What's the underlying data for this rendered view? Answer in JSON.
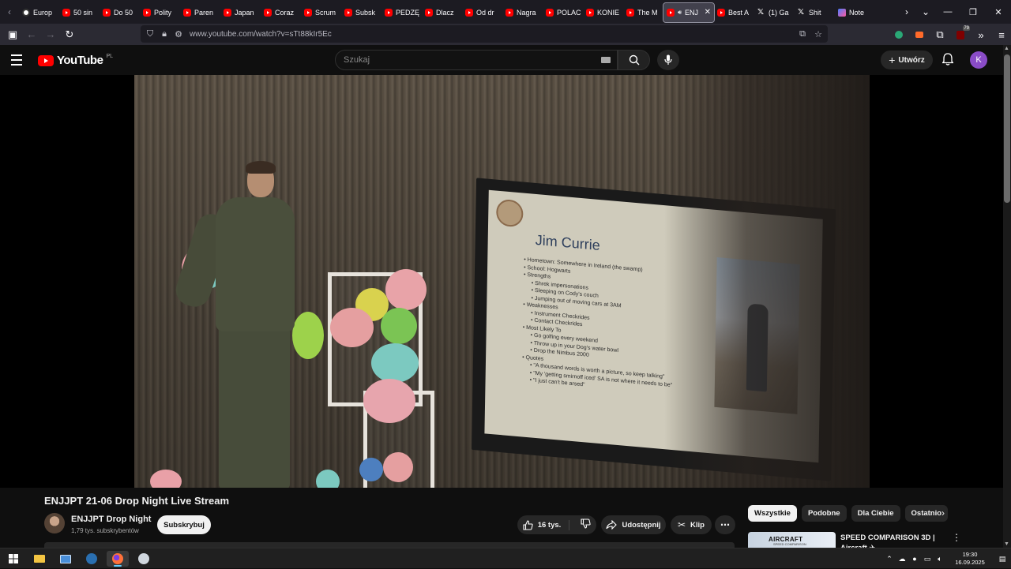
{
  "browser": {
    "tabs": [
      {
        "label": "Europ",
        "icon": "globe-icon"
      },
      {
        "label": "50 sin",
        "icon": "youtube-icon"
      },
      {
        "label": "Do 50",
        "icon": "youtube-icon"
      },
      {
        "label": "Polity",
        "icon": "youtube-icon"
      },
      {
        "label": "Paren",
        "icon": "youtube-icon"
      },
      {
        "label": "Japan",
        "icon": "youtube-icon"
      },
      {
        "label": "Coraz",
        "icon": "youtube-icon"
      },
      {
        "label": "Scrum",
        "icon": "youtube-icon"
      },
      {
        "label": "Subsk",
        "icon": "youtube-icon"
      },
      {
        "label": "PEDZĘ",
        "icon": "youtube-icon"
      },
      {
        "label": "Dlacz",
        "icon": "youtube-icon"
      },
      {
        "label": "Od dr",
        "icon": "youtube-icon"
      },
      {
        "label": "Nagra",
        "icon": "youtube-icon"
      },
      {
        "label": "POLAC",
        "icon": "youtube-icon"
      },
      {
        "label": "KONIE",
        "icon": "youtube-icon"
      },
      {
        "label": "The M",
        "icon": "youtube-icon"
      },
      {
        "label": "ENJ",
        "icon": "youtube-icon",
        "active": true
      },
      {
        "label": "Best A",
        "icon": "youtube-icon"
      },
      {
        "label": "(1) Ga",
        "icon": "x-icon"
      },
      {
        "label": "Shit",
        "icon": "x-icon"
      },
      {
        "label": "Note",
        "icon": "note-icon"
      }
    ],
    "url": "www.youtube.com/watch?v=sTt88kIr5Ec",
    "extension_badge": "79"
  },
  "youtube": {
    "logo_text": "YouTube",
    "country_code": "PL",
    "search_placeholder": "Szukaj",
    "create_label": "Utwórz",
    "avatar_letter": "K",
    "avatar_color": "#8a4cc7"
  },
  "slide": {
    "title": "Jim Currie",
    "lines": [
      {
        "level": 1,
        "text": "• Hometown:  Somewhere in Ireland (the swamp)"
      },
      {
        "level": 1,
        "text": "• School: Hogwarts"
      },
      {
        "level": 1,
        "text": "• Strengths"
      },
      {
        "level": 2,
        "text": "• Shrek impersonations"
      },
      {
        "level": 2,
        "text": "• Sleeping on Cody's couch"
      },
      {
        "level": 2,
        "text": "• Jumping out of moving cars at 3AM"
      },
      {
        "level": 1,
        "text": "• Weaknesses"
      },
      {
        "level": 2,
        "text": "• Instrument Checkrides"
      },
      {
        "level": 2,
        "text": "• Contact Checkrides"
      },
      {
        "level": 1,
        "text": "• Most Likely To"
      },
      {
        "level": 2,
        "text": "• Go golfing every weekend"
      },
      {
        "level": 2,
        "text": "• Throw up in your Dog's water bowl"
      },
      {
        "level": 2,
        "text": "• Drop the Nimbus 2000"
      },
      {
        "level": 1,
        "text": "• Quotes"
      },
      {
        "level": 2,
        "text": "• \"A thousand words is worth a picture, so keep talking\""
      },
      {
        "level": 2,
        "text": "• \"My 'getting smirnoff iced' SA is not where it needs to be\""
      },
      {
        "level": 2,
        "text": "• \"I just can't be arsed\""
      }
    ]
  },
  "video": {
    "title": "ENJJPT 21-06 Drop Night Live Stream",
    "channel_name": "ENJJPT Drop Night",
    "channel_subs": "1,79 tys. subskrybentów",
    "subscribe_label": "Subskrybuj",
    "likes": "16 tys.",
    "share_label": "Udostępnij",
    "clip_label": "Klip"
  },
  "sidebar": {
    "chips": [
      "Wszystkie",
      "Podobne",
      "Dla Ciebie",
      "Ostatnio"
    ],
    "active_chip": "Wszystkie",
    "recommendation": {
      "thumb_text": "AIRCRAFT",
      "thumb_sub": "SPEED COMPARISON",
      "title": "SPEED COMPARISON 3D | Aircraft ✈"
    }
  },
  "taskbar": {
    "time": "19:30",
    "date": "16.09.2025"
  }
}
